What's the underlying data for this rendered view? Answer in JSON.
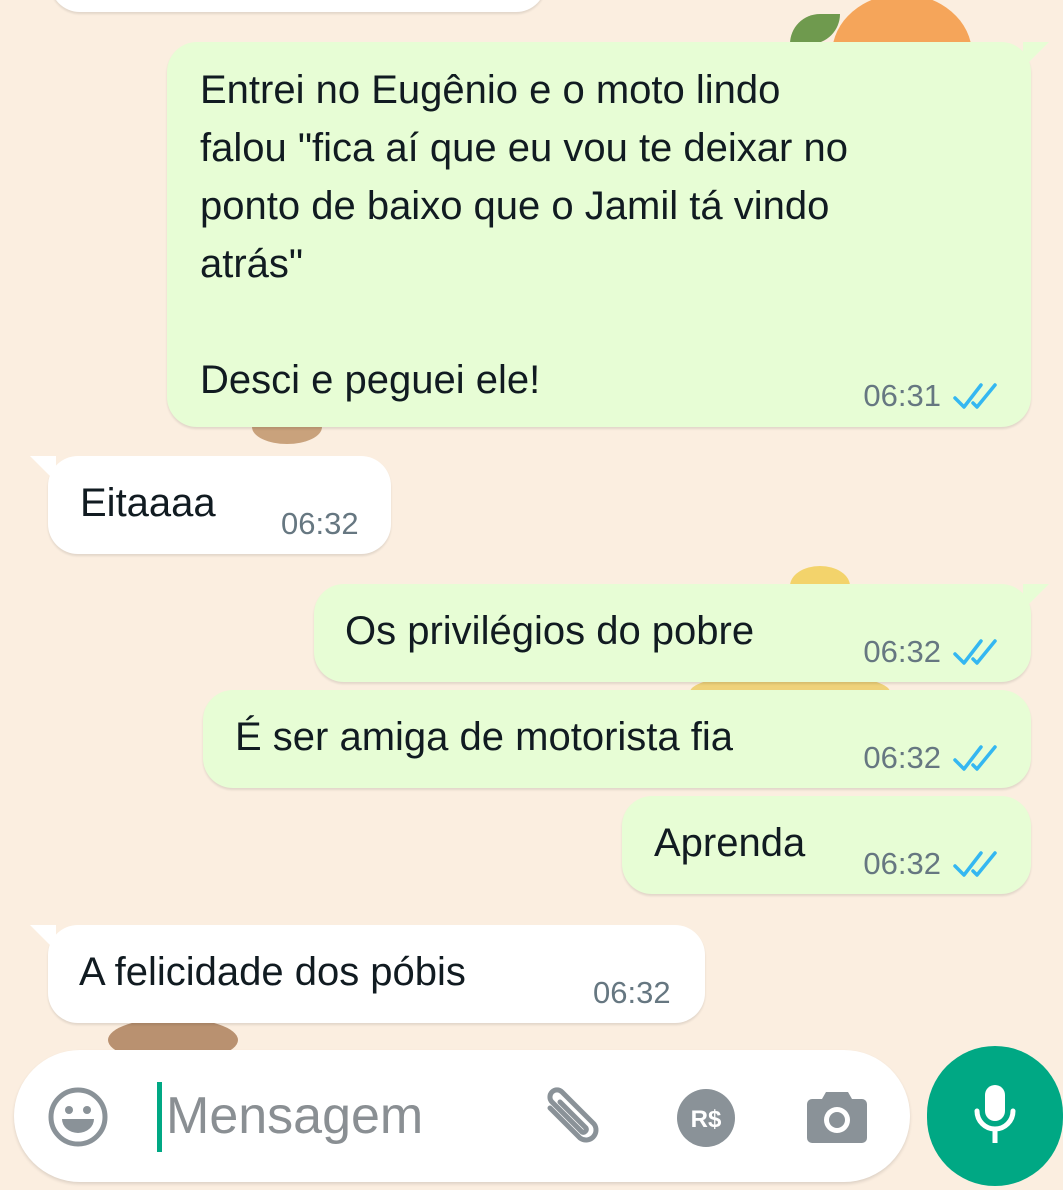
{
  "chat": {
    "messages": [
      {
        "direction": "out",
        "text": "Entrei no Eugênio e o moto lindo\nfalou \"fica aí que eu vou te deixar no\nponto de baixo que o Jamil tá vindo\natrás\"\n\nDesci e peguei ele!",
        "time": "06:31",
        "status": "read"
      },
      {
        "direction": "in",
        "text": "Eitaaaa",
        "time": "06:32"
      },
      {
        "direction": "out",
        "text": "Os privilégios do pobre",
        "time": "06:32",
        "status": "read"
      },
      {
        "direction": "out",
        "text": "É ser amiga de motorista fia",
        "time": "06:32",
        "status": "read"
      },
      {
        "direction": "out",
        "text": "Aprenda",
        "time": "06:32",
        "status": "read"
      },
      {
        "direction": "in",
        "text": "A felicidade dos póbis",
        "time": "06:32"
      }
    ]
  },
  "composer": {
    "placeholder": "Mensagem",
    "icons": [
      "emoji-icon",
      "attach-icon",
      "payment-icon",
      "camera-icon",
      "mic-icon"
    ],
    "payment_label": "R$"
  },
  "colors": {
    "background": "#fbeee0",
    "outgoing_bubble": "#e7fdd5",
    "incoming_bubble": "#ffffff",
    "read_ticks": "#34b7f1",
    "accent": "#00a884"
  }
}
